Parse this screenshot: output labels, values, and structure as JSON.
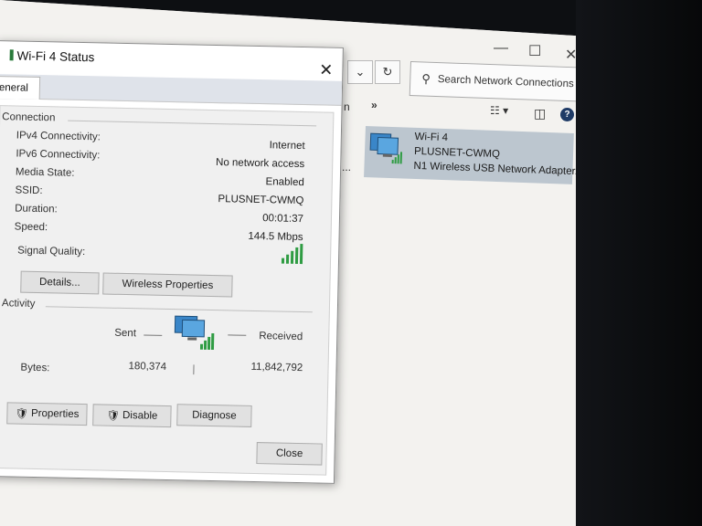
{
  "network_window": {
    "search_placeholder": "Search Network Connections",
    "chevron_label": "»",
    "partial_menu_text": "n",
    "ellipsis": "...",
    "adapter": {
      "name": "Wi-Fi 4",
      "network": "PLUSNET-CWMQ",
      "device": "N1 Wireless USB Network Adapter..."
    }
  },
  "dialog": {
    "title": "Wi-Fi 4 Status",
    "tab_general": "eneral",
    "connection": {
      "group_label": "Connection",
      "rows": [
        {
          "label": "IPv4 Connectivity:",
          "value": "Internet"
        },
        {
          "label": "IPv6 Connectivity:",
          "value": "No network access"
        },
        {
          "label": "Media State:",
          "value": "Enabled"
        },
        {
          "label": "SSID:",
          "value": "PLUSNET-CWMQ"
        },
        {
          "label": "Duration:",
          "value": "00:01:37"
        },
        {
          "label": "Speed:",
          "value": "144.5 Mbps"
        }
      ],
      "signal_label": "Signal Quality:",
      "signal_bars": 5,
      "details_button": "Details...",
      "wireless_button": "Wireless Properties"
    },
    "activity": {
      "group_label": "Activity",
      "sent_label": "Sent",
      "received_label": "Received",
      "bytes_label": "Bytes:",
      "bytes_sent": "180,374",
      "bytes_received": "11,842,792",
      "divider": "|"
    },
    "buttons": {
      "properties": "Properties",
      "disable": "Disable",
      "diagnose": "Diagnose",
      "close": "Close"
    }
  },
  "colors": {
    "signal_green": "#2f9c43",
    "adapter_highlight": "#bcc6cf"
  }
}
